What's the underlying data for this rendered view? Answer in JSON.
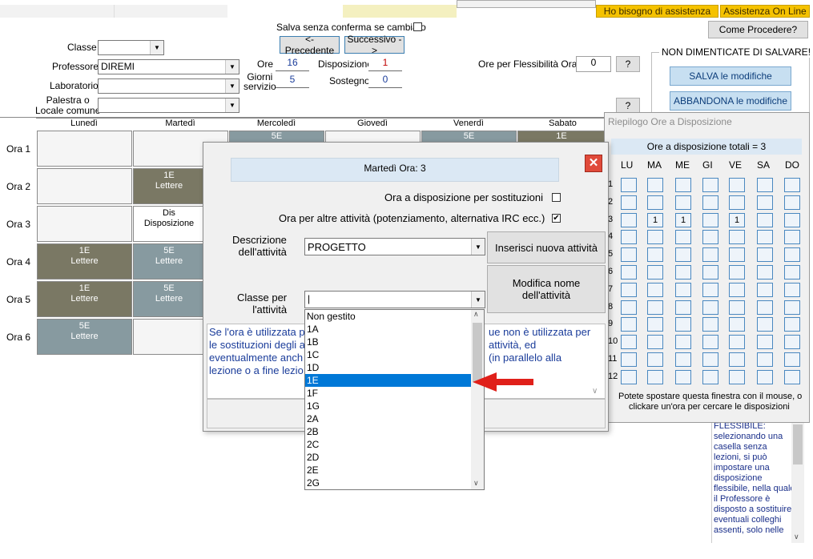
{
  "top_bar": {
    "assistance_button": "Ho bisogno di assistenza",
    "online_button": "Assistenza On Line",
    "how_button": "Come  Procedere?",
    "save_no_confirm": "Salva senza conferma se cambiato",
    "prev_button": "<- Precedente",
    "next_button": "Successivo ->"
  },
  "form": {
    "classe_label": "Classe",
    "professore_label": "Professore",
    "professore_value": "DIREMI",
    "laboratorio_label": "Laboratorio",
    "palestra_label_1": "Palestra o",
    "palestra_label_2": "Locale comune",
    "ore_label": "Ore",
    "ore_value": "16",
    "giorni_label_1": "Giorni",
    "giorni_label_2": "servizio",
    "giorni_value": "5",
    "disposizione_label": "Disposizione",
    "disposizione_value": "1",
    "sostegno_label": "Sostegno",
    "sostegno_value": "0",
    "flessibilita_label": "Ore per Flessibilità Oraria",
    "flessibilita_value": "0",
    "help_button": "?"
  },
  "reminder": {
    "legend": "NON DIMENTICATE DI SALVARE!",
    "save_button": "SALVA le modifiche",
    "abandon_button": "ABBANDONA le modifiche"
  },
  "timetable": {
    "days": [
      "Lunedì",
      "Martedì",
      "Mercoledì",
      "Giovedì",
      "Venerdì",
      "Sabato"
    ],
    "rows": [
      "Ora 1",
      "Ora 2",
      "Ora 3",
      "Ora 4",
      "Ora 5",
      "Ora 6"
    ],
    "cells": {
      "mer1": "5E",
      "ven1": "5E",
      "sab1": "1E",
      "mar2a": "1E",
      "mar2b": "Lettere",
      "mar3a": "Dis",
      "mar3b": "Disposizione",
      "lun4a": "1E",
      "lun4b": "Lettere",
      "mar4a": "5E",
      "mar4b": "Lettere",
      "lun5a": "1E",
      "lun5b": "Lettere",
      "mar5a": "5E",
      "mar5b": "Lettere",
      "lun6a": "5E",
      "lun6b": "Lettere"
    }
  },
  "dialog": {
    "title": "Martedì Ora: 3",
    "close_icon": "close-icon",
    "sostituzioni_label": "Ora a disposizione per sostituzioni",
    "altre_label": "Ora per altre attività (potenziamento, alternativa IRC ecc.)",
    "altre_checked": "✔",
    "descrizione_label_1": "Descrizione",
    "descrizione_label_2": "dell'attività",
    "descrizione_value": "PROGETTO",
    "insert_button": "Inserisci nuova attività",
    "modify_button_1": "Modifica nome",
    "modify_button_2": "dell'attività",
    "classe_label_1": "Classe per",
    "classe_label_2": "l'attività",
    "info_line1": "Se l'ora è utilizzata p",
    "info_line1b": "ue non è utilizzata per",
    "info_line2": "le sostituzioni degli a",
    "info_line2b": "attività, ed",
    "info_line3": "eventualmente anch",
    "info_line3b": "(in parallelo alla",
    "info_line4": "lezione o a fine lezio",
    "dropdown_items": [
      "Non gestito",
      "1A",
      "1B",
      "1C",
      "1D",
      "1E",
      "1F",
      "1G",
      "2A",
      "2B",
      "2C",
      "2D",
      "2E",
      "2G"
    ],
    "dropdown_selected": "1E"
  },
  "riepilogo": {
    "title": "Riepilogo Ore a Disposizione",
    "total": "Ore a disposizione totali = 3",
    "days": [
      "LU",
      "MA",
      "ME",
      "GI",
      "VE",
      "SA",
      "DO"
    ],
    "hours": [
      "1",
      "2",
      "3",
      "4",
      "5",
      "6",
      "7",
      "8",
      "9",
      "10",
      "11",
      "12"
    ],
    "row3_values": [
      "",
      "1",
      "1",
      "",
      "1",
      "",
      ""
    ],
    "footer_1": "Potete spostare questa finestra con il mouse, o",
    "footer_2": "clickare un'ora per cercare le disposizioni"
  },
  "side_help": {
    "lines": [
      "FLESSIBILE:",
      "selezionando una",
      "casella senza",
      "lezioni, si può",
      "impostare una",
      "disposizione",
      "flessibile, nella quale",
      "il Professore è",
      "disposto a sostituire",
      "eventuali colleghi",
      "assenti, solo nelle"
    ]
  },
  "colors": {
    "olive": "#7a7864",
    "steel": "#879aa0",
    "selection": "#0078d7",
    "orange_button": "#f5c200",
    "close_red": "#e04a3a"
  }
}
